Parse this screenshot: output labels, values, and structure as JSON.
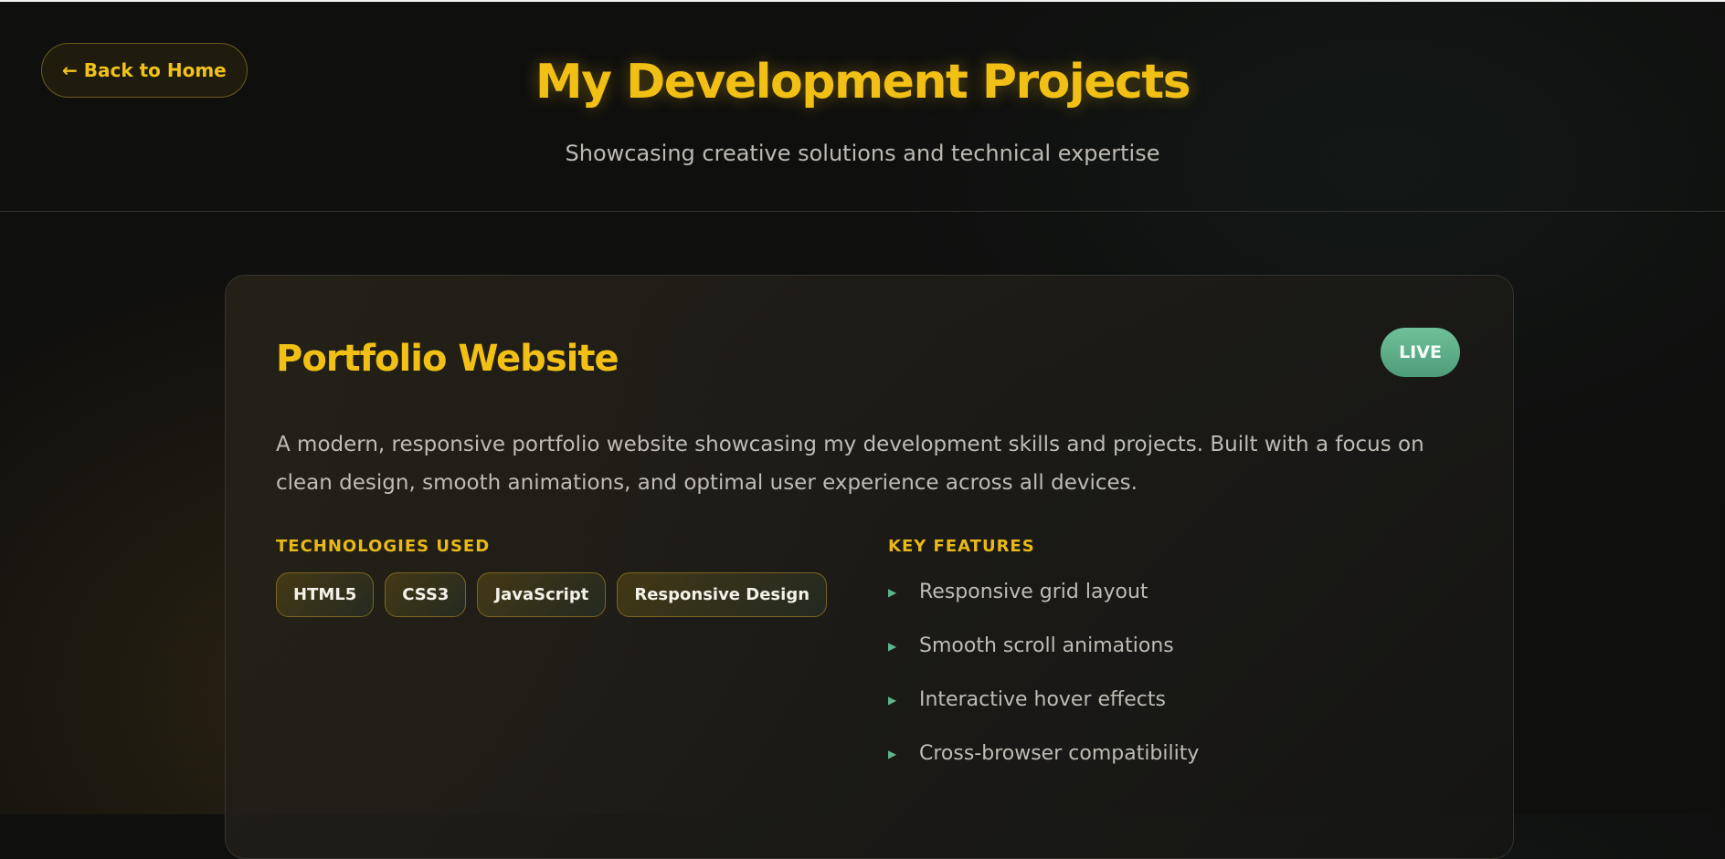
{
  "header": {
    "back_label": "← Back to Home",
    "title": "My Development Projects",
    "subtitle": "Showcasing creative solutions and technical expertise"
  },
  "project": {
    "title": "Portfolio Website",
    "status": "LIVE",
    "description": "A modern, responsive portfolio website showcasing my development skills and projects. Built with a focus on clean design, smooth animations, and optimal user experience across all devices.",
    "technologies_label": "TECHNOLOGIES USED",
    "technologies": [
      "HTML5",
      "CSS3",
      "JavaScript",
      "Responsive Design"
    ],
    "features_label": "KEY FEATURES",
    "features": [
      "Responsive grid layout",
      "Smooth scroll animations",
      "Interactive hover effects",
      "Cross-browser compatibility"
    ]
  },
  "colors": {
    "accent": "#f2c014",
    "live": "#5fb28c",
    "background": "#0f0f0e"
  },
  "icons": {
    "back": "left-arrow-icon",
    "feature_bullet": "triangle-bullet-icon"
  }
}
